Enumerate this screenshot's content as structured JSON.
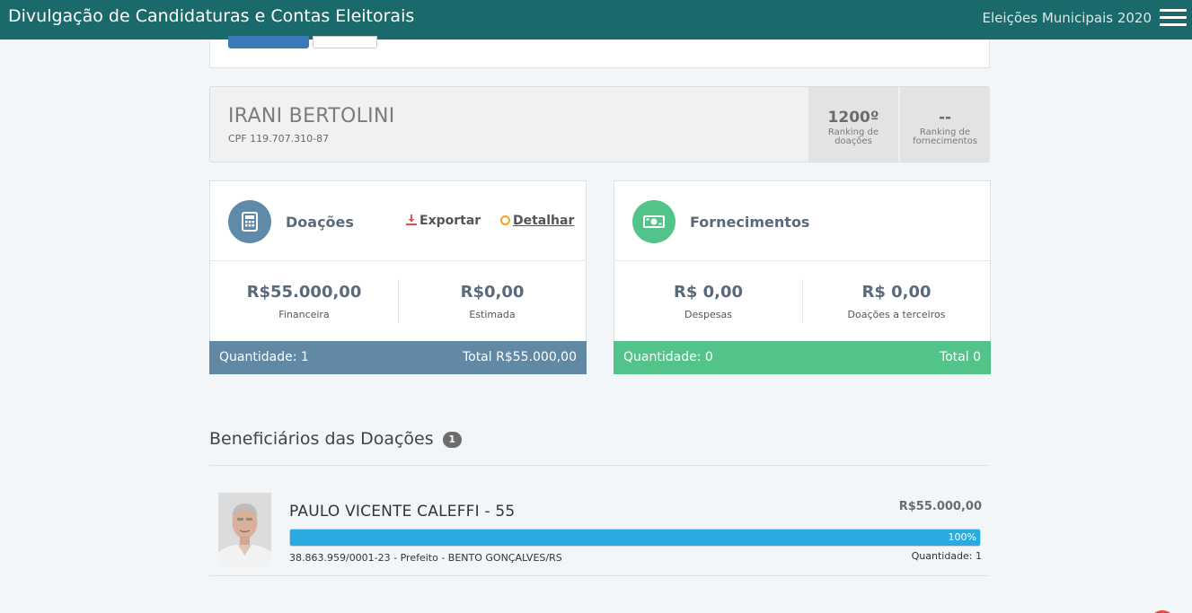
{
  "header": {
    "title": "Divulgação de Candidaturas e Contas Eleitorais",
    "election": "Eleições Municipais 2020"
  },
  "candidate": {
    "name": "IRANI BERTOLINI",
    "cpf": "CPF 119.707.310-87",
    "ranking_donations_value": "1200º",
    "ranking_donations_label": "Ranking de doações",
    "ranking_supplies_value": "--",
    "ranking_supplies_label": "Ranking de fornecimentos"
  },
  "donations_card": {
    "title": "Doações",
    "export_label": "Exportar",
    "detail_label": "Detalhar",
    "financial_value": "R$55.000,00",
    "financial_label": "Financeira",
    "estimated_value": "R$0,00",
    "estimated_label": "Estimada",
    "quantity": "Quantidade: 1",
    "total": "Total R$55.000,00",
    "colors": {
      "icon": "#5f8aa8",
      "footer": "#6189a6"
    }
  },
  "supplies_card": {
    "title": "Fornecimentos",
    "expenses_value": "R$ 0,00",
    "expenses_label": "Despesas",
    "third_party_value": "R$ 0,00",
    "third_party_label": "Doações a terceiros",
    "quantity": "Quantidade: 0",
    "total": "Total 0",
    "colors": {
      "icon": "#52c389",
      "footer": "#52c389"
    }
  },
  "beneficiaries": {
    "title": "Beneficiários das Doações",
    "count": "1",
    "items": [
      {
        "name": "PAULO VICENTE CALEFFI - 55",
        "amount": "R$55.000,00",
        "percent": 100,
        "percent_label": "100%",
        "details": "38.863.959/0001-23 - Prefeito - BENTO GONÇALVES/RS",
        "quantity": "Quantidade: 1"
      }
    ]
  },
  "icons": {
    "donations": "calculator-icon",
    "supplies": "money-bill-icon",
    "export": "download-icon",
    "detail": "circle-icon",
    "menu": "hamburger-menu-icon"
  }
}
